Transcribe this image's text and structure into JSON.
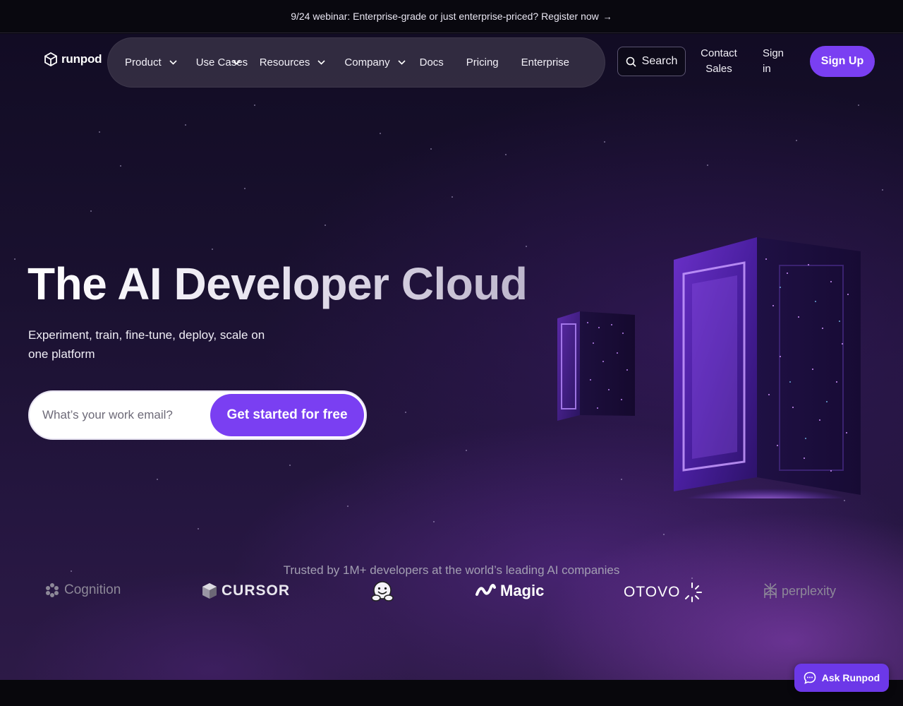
{
  "announcement": {
    "text": "9/24 webinar: Enterprise-grade or just enterprise-priced? Register now",
    "arrow": "→"
  },
  "brand": {
    "name": "runpod",
    "accent": "#7a3ff2"
  },
  "nav": {
    "items": [
      {
        "label": "Product",
        "dropdown": true
      },
      {
        "label": "Use Cases",
        "dropdown": true
      },
      {
        "label": "Resources",
        "dropdown": true
      },
      {
        "label": "Company",
        "dropdown": true
      },
      {
        "label": "Docs",
        "dropdown": false
      },
      {
        "label": "Pricing",
        "dropdown": false
      },
      {
        "label": "Enterprise",
        "dropdown": false
      }
    ],
    "search_label": "Search",
    "contact_label": "Contact Sales",
    "signin_label": "Sign in",
    "signup_label": "Sign Up"
  },
  "hero": {
    "title": "The AI Developer Cloud",
    "subtitle": "Experiment, train, fine-tune, deploy, scale on one platform",
    "email_placeholder": "What’s your work email?",
    "cta_label": "Get started for free"
  },
  "trusted": {
    "text": "Trusted by 1M+ developers at the world’s leading AI companies",
    "logos": [
      "Cognition",
      "CURSOR",
      "hugging-face-icon",
      "Magic",
      "OTOVO",
      "perplexity"
    ]
  },
  "chat": {
    "label": "Ask Runpod"
  }
}
